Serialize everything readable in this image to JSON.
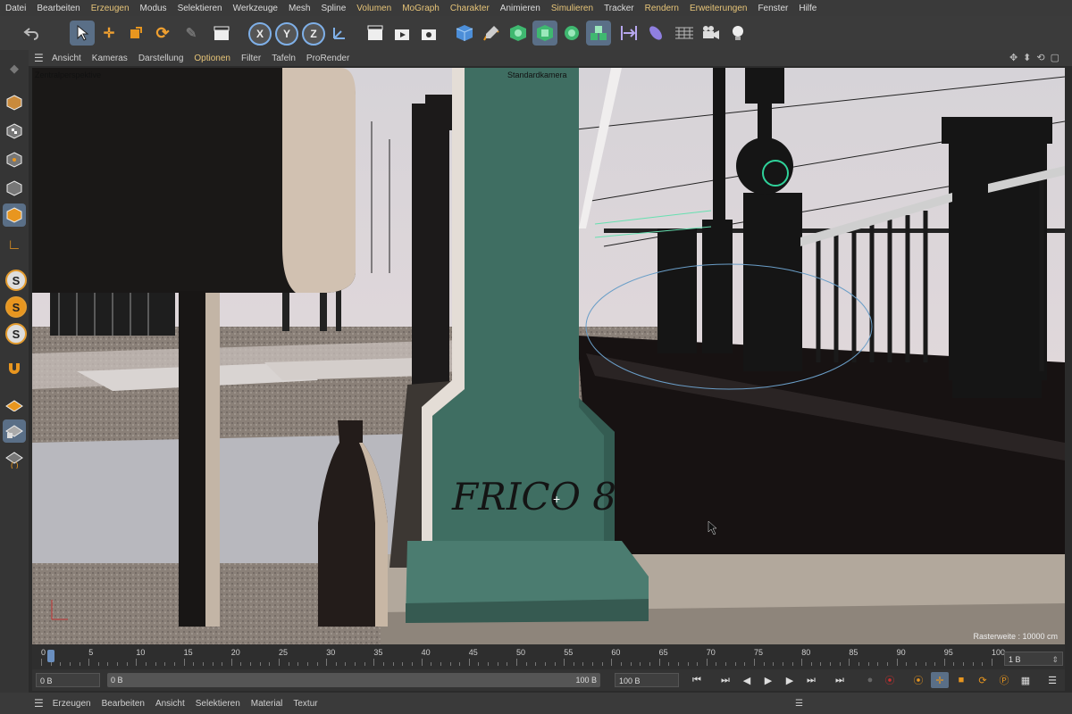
{
  "menu": [
    "Datei",
    "Bearbeiten",
    "Erzeugen",
    "Modus",
    "Selektieren",
    "Werkzeuge",
    "Mesh",
    "Spline",
    "Volumen",
    "MoGraph",
    "Charakter",
    "Animieren",
    "Simulieren",
    "Tracker",
    "Rendern",
    "Erweiterungen",
    "Fenster",
    "Hilfe"
  ],
  "toolbar": {
    "undo_icon": "undo-icon",
    "axis_x": "X",
    "axis_y": "Y",
    "axis_z": "Z"
  },
  "view_menu": [
    "Ansicht",
    "Kameras",
    "Darstellung",
    "Optionen",
    "Filter",
    "Tafeln",
    "ProRender"
  ],
  "viewport": {
    "projection_label": "Zentralperspektive",
    "camera_label": "Standardkamera",
    "grid_label": "Rasterweite : 10000 cm",
    "graffiti": "FRICO 8"
  },
  "timeline": {
    "ticks": [
      "0",
      "5",
      "10",
      "15",
      "20",
      "25",
      "30",
      "35",
      "40",
      "45",
      "50",
      "55",
      "60",
      "65",
      "70",
      "75",
      "80",
      "85",
      "90",
      "95",
      "100"
    ],
    "current_frame": "0 B",
    "end_frame_box": "1 B"
  },
  "playback": {
    "start_field": "0 B",
    "slider_start": "0 B",
    "slider_end": "100 B",
    "end_field": "100 B"
  },
  "bottom_menu": [
    "Erzeugen",
    "Bearbeiten",
    "Ansicht",
    "Selektieren",
    "Material",
    "Textur"
  ],
  "colors": {
    "menu_accent": "#e6c478",
    "active_tool": "#5a6f87",
    "column_green": "#3f6e62"
  }
}
